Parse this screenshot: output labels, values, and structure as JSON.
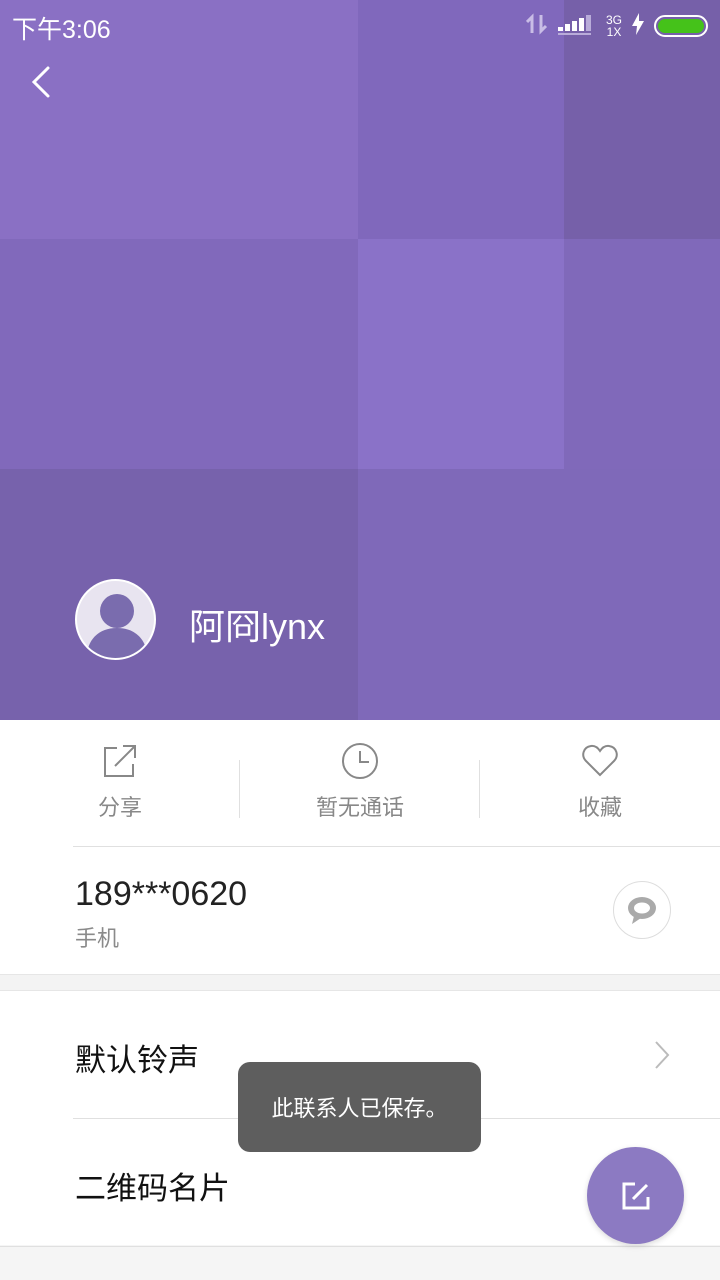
{
  "status_bar": {
    "time": "下午3:06",
    "network_top": "3G",
    "network_bottom": "1X",
    "icons": [
      "data-arrows-icon",
      "signal-bars-icon",
      "charging-bolt-icon",
      "battery-icon"
    ],
    "battery_color": "#45c21a"
  },
  "contact": {
    "name": "阿冏lynx",
    "avatar_icon": "person-silhouette-icon"
  },
  "actions": [
    {
      "label": "分享",
      "icon": "share-icon"
    },
    {
      "label": "暂无通话",
      "icon": "clock-icon"
    },
    {
      "label": "收藏",
      "icon": "heart-icon"
    }
  ],
  "phone": {
    "number": "189***0620",
    "type": "手机",
    "message_icon": "message-bubble-icon"
  },
  "settings": {
    "ringtone_label": "默认铃声",
    "qrcode_label": "二维码名片"
  },
  "toast": {
    "text": "此联系人已保存。"
  },
  "fab": {
    "icon": "edit-icon",
    "color": "#8c7ac2"
  },
  "colors": {
    "header_accent": "#8069b8"
  }
}
